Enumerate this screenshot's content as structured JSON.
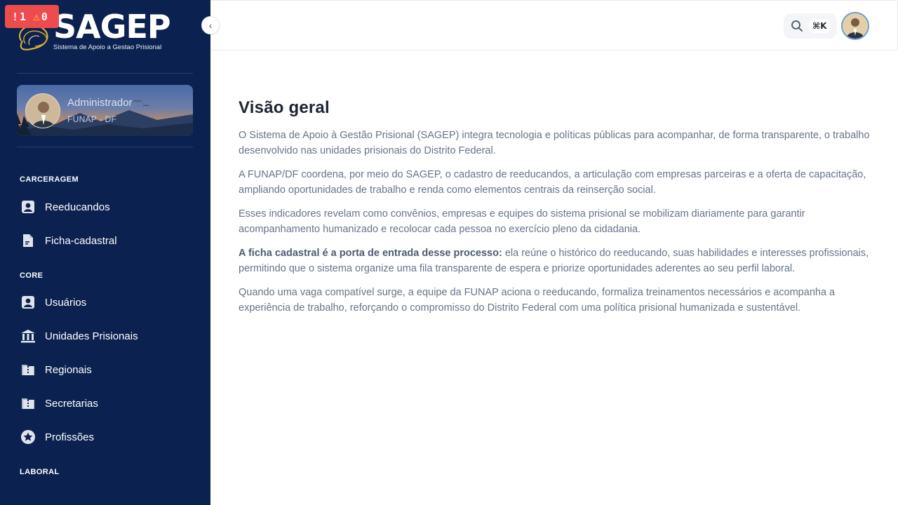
{
  "debug": {
    "errors": "1",
    "warnings": "0"
  },
  "brand": {
    "name": "SAGEP",
    "subtitle": "Sistema de Apoio a Gestao Prisional"
  },
  "profile": {
    "name": "Administrador",
    "org": "FUNAP - DF"
  },
  "sidebar": {
    "sections": [
      {
        "title": "CARCERAGEM",
        "items": [
          {
            "label": "Reeducandos",
            "icon": "user-icon"
          },
          {
            "label": "Ficha-cadastral",
            "icon": "file-icon"
          }
        ]
      },
      {
        "title": "CORE",
        "items": [
          {
            "label": "Usuários",
            "icon": "user-icon"
          },
          {
            "label": "Unidades Prisionais",
            "icon": "bank-icon"
          },
          {
            "label": "Regionais",
            "icon": "folder-icon"
          },
          {
            "label": "Secretarias",
            "icon": "folder-icon"
          },
          {
            "label": "Profissões",
            "icon": "star-icon"
          }
        ]
      },
      {
        "title": "LABORAL",
        "items": []
      }
    ]
  },
  "header": {
    "shortcut": "⌘K"
  },
  "main": {
    "title": "Visão geral",
    "paragraphs": [
      "O Sistema de Apoio à Gestão Prisional (SAGEP) integra tecnologia e políticas públicas para acompanhar, de forma transparente, o trabalho desenvolvido nas unidades prisionais do Distrito Federal.",
      "A FUNAP/DF coordena, por meio do SAGEP, o cadastro de reeducandos, a articulação com empresas parceiras e a oferta de capacitação, ampliando oportunidades de trabalho e renda como elementos centrais da reinserção social.",
      "Esses indicadores revelam como convênios, empresas e equipes do sistema prisional se mobilizam diariamente para garantir acompanhamento humanizado e recolocar cada pessoa no exercício pleno da cidadania."
    ],
    "highlight_lead": "A ficha cadastral é a porta de entrada desse processo:",
    "highlight_rest": " ela reúne o histórico do reeducando, suas habilidades e interesses profissionais, permitindo que o sistema organize uma fila transparente de espera e priorize oportunidades aderentes ao seu perfil laboral.",
    "closing": "Quando uma vaga compatível surge, a equipe da FUNAP aciona o reeducando, formaliza treinamentos necessários e acompanha a experiência de trabalho, reforçando o compromisso do Distrito Federal com uma política prisional humanizada e sustentável."
  }
}
